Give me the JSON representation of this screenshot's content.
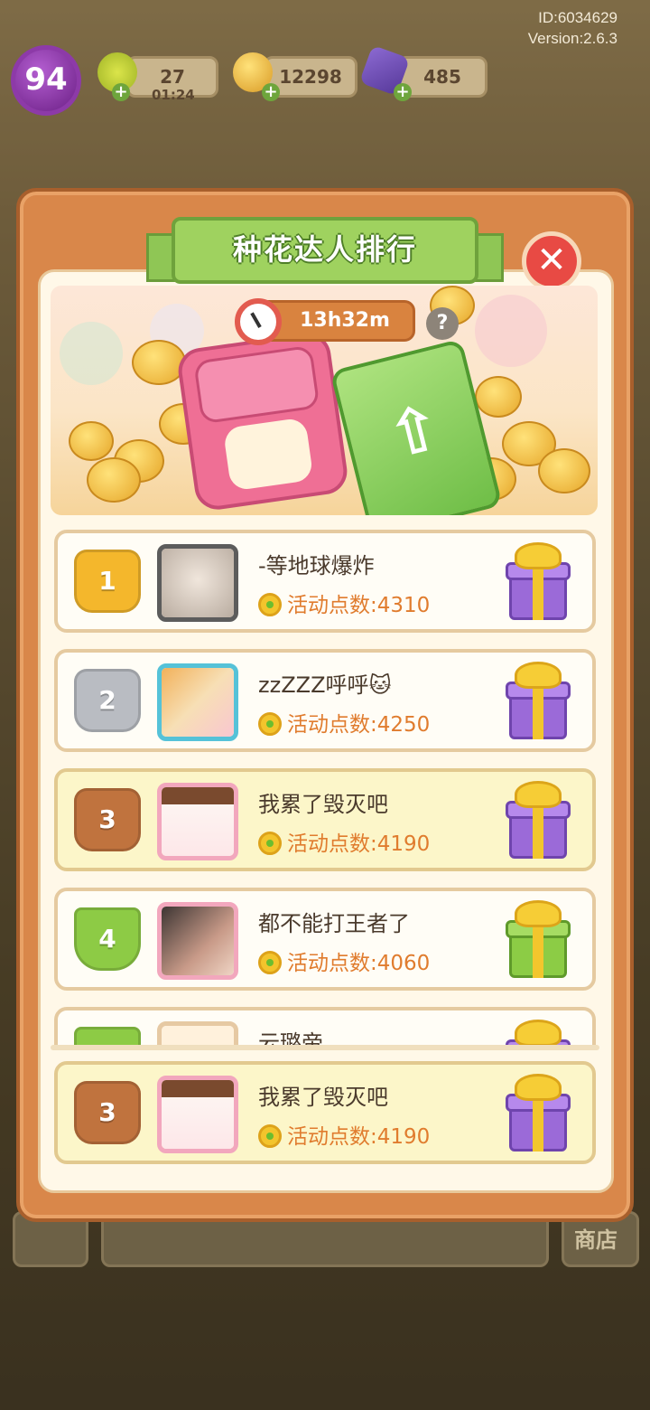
{
  "account": {
    "id_text": "ID:6034629",
    "version_text": "Version:2.6.3"
  },
  "hud": {
    "level": "94",
    "energy": "27",
    "energy_timer": "01:24",
    "coins": "12298",
    "gems": "485",
    "shop_label": "商店"
  },
  "panel": {
    "title": "种花达人排行",
    "close_icon": "close-icon",
    "timer": "13h32m",
    "help_label": "?"
  },
  "rankings": [
    {
      "rank": "1",
      "badge": "gold-crown",
      "name": "-等地球爆炸",
      "points_label": "活动点数:4310",
      "gift": "purple",
      "avatar_color": "#d8cfc4"
    },
    {
      "rank": "2",
      "badge": "silver-crown",
      "name": "zzZZZ呼呼🐱",
      "points_label": "活动点数:4250",
      "gift": "purple",
      "avatar_color": "#f4d3a0"
    },
    {
      "rank": "3",
      "badge": "bronze-crown",
      "name": "我累了毁灭吧",
      "points_label": "活动点数:4190",
      "gift": "purple",
      "avatar_color": "#fbe7e9",
      "highlight": true
    },
    {
      "rank": "4",
      "badge": "green-flag",
      "name": "都不能打王者了",
      "points_label": "活动点数:4060",
      "gift": "green",
      "avatar_color": "#c9a79a"
    },
    {
      "rank": "",
      "badge": "green-flag",
      "name": "云璐帝",
      "points_label": "",
      "gift": "purple",
      "avatar_color": "#fff1dc"
    }
  ],
  "self_entry": {
    "rank": "3",
    "name": "我累了毁灭吧",
    "points_label": "活动点数:4190"
  },
  "colors": {
    "gold": "#f4b72c",
    "silver": "#b9bcc2",
    "bronze": "#c0733e",
    "green_flag": "#8dcb45",
    "gift_purple": "#9b6ad8",
    "gift_green": "#8ccc45",
    "points_orange": "#e07c2e"
  }
}
